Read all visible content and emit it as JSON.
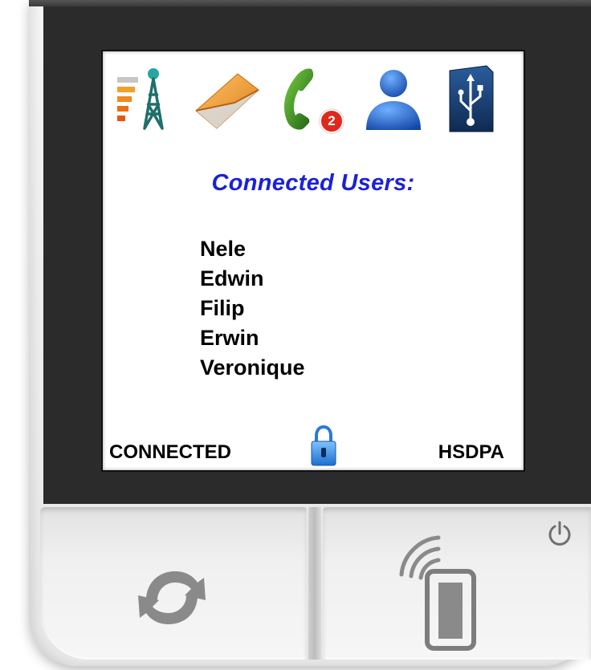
{
  "status_icons": [
    "signal-tower-icon",
    "mail-envelope-icon",
    "phone-icon",
    "user-icon",
    "usb-icon"
  ],
  "phone_badge": "2",
  "title": "Connected Users:",
  "users": [
    "Nele",
    "Edwin",
    "Filip",
    "Erwin",
    "Veronique"
  ],
  "status": {
    "left": "CONNECTED",
    "right": "HSDPA",
    "center_icon": "lock-icon"
  },
  "buttons": {
    "left_icon": "refresh-icon",
    "right_icon": "nfc-phone-icon",
    "power_icon": "power-icon"
  },
  "colors": {
    "title": "#1a22d6",
    "bezel": "#2b2b2b",
    "screen": "#ffffff",
    "signal_bars": "#f08a1c",
    "tower": "#1f8a86",
    "phone_green": "#2f8a1e",
    "badge_red": "#e0281c",
    "user_blue": "#1e63c9",
    "usb_bg": "#1c3c6e"
  }
}
